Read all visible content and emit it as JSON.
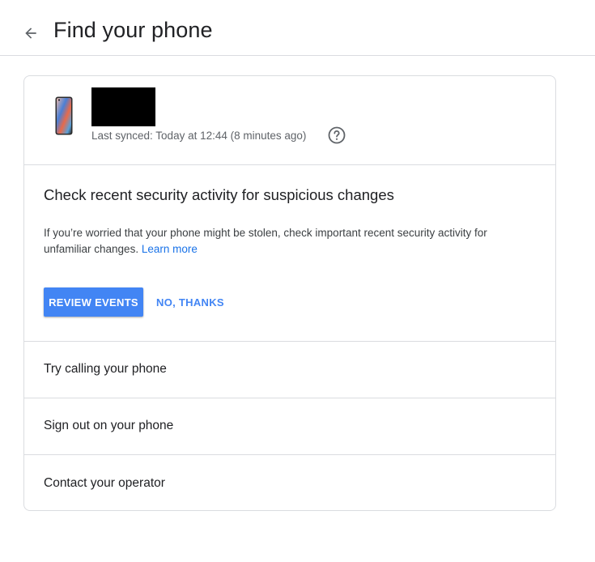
{
  "header": {
    "back_icon": "arrow-back-icon",
    "title": "Find your phone"
  },
  "device": {
    "image_icon": "phone-icon",
    "name": "",
    "last_synced": "Last synced: Today at 12:44 (8 minutes ago)",
    "help_icon": "help-circle-icon"
  },
  "security": {
    "title": "Check recent security activity for suspicious changes",
    "description": "If you’re worried that your phone might be stolen, check important recent security activity for unfamiliar changes.",
    "learn_more": "Learn more",
    "review_label": "REVIEW EVENTS",
    "no_thanks_label": "NO, THANKS"
  },
  "options": [
    {
      "label": "Try calling your phone"
    },
    {
      "label": "Sign out on your phone"
    },
    {
      "label": "Contact your operator"
    }
  ],
  "colors": {
    "accent": "#4285f4",
    "link": "#1a73e8",
    "divider": "#dadce0",
    "redacted": "#000000"
  }
}
